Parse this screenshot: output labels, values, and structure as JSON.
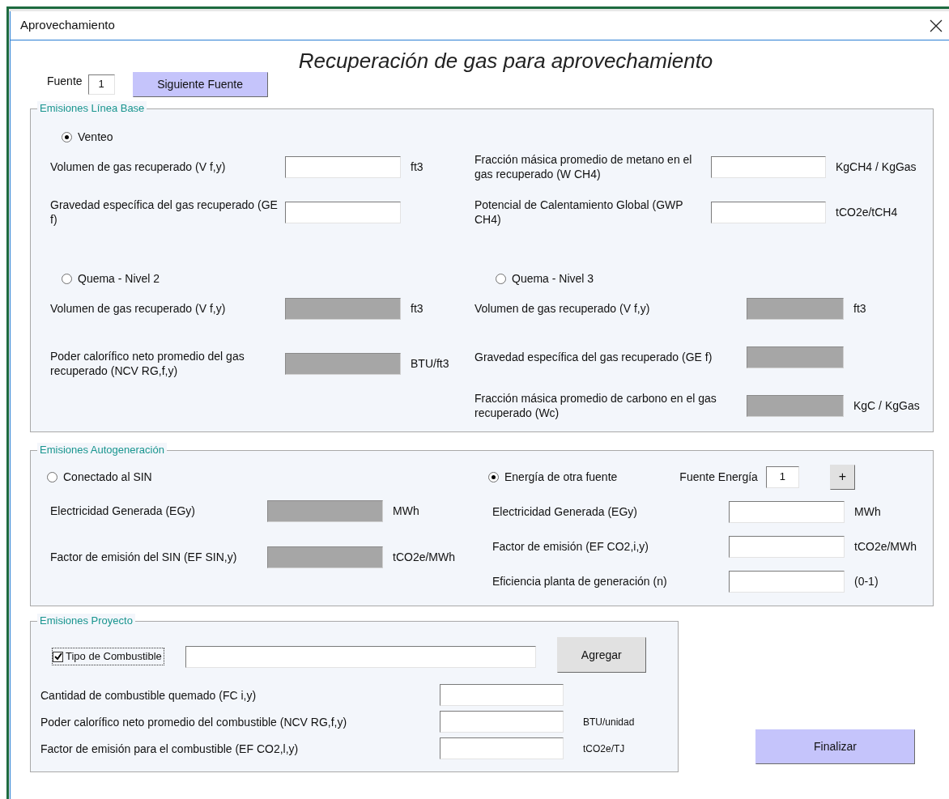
{
  "window": {
    "title": "Aprovechamiento"
  },
  "heading": "Recuperación de gas para aprovechamiento",
  "source": {
    "label": "Fuente",
    "value": "1",
    "button": "Siguiente  Fuente"
  },
  "baseline": {
    "legend": "Emisiones Línea Base",
    "blocks": [
      {
        "options": [
          {
            "label": "Venteo",
            "selected": true
          }
        ],
        "left": [
          {
            "label": "Volumen de gas recuperado (V f,y)",
            "unit": "ft3",
            "disabled": false
          },
          {
            "label": "Gravedad específica del gas recuperado (GE f)",
            "disabled": false
          }
        ],
        "right": [
          {
            "label": "Fracción másica promedio de metano en el gas recuperado (W CH4)",
            "unit": "KgCH4 / KgGas",
            "disabled": false
          },
          {
            "label": "Potencial de Calentamiento Global (GWP CH4)",
            "unit": "tCO2e/tCH4",
            "disabled": false
          }
        ]
      },
      {
        "options": [
          {
            "label": "Quema - Nivel 2",
            "selected": false
          },
          {
            "label": "Quema - Nivel 3",
            "selected": false
          }
        ],
        "left": [
          {
            "label": "Volumen de gas recuperado (V f,y)",
            "unit": "ft3",
            "disabled": true
          },
          {
            "label": "Poder calorífico neto promedio del gas recuperado (NCV RG,f,y)",
            "unit": "BTU/ft3",
            "disabled": true
          }
        ],
        "right": [
          {
            "label": "Volumen de gas recuperado (V f,y)",
            "unit": "ft3",
            "disabled": true
          },
          {
            "label": "Gravedad específica del gas recuperado (GE f)",
            "disabled": true
          },
          {
            "label": "Fracción másica promedio de carbono en el gas recuperado (Wc)",
            "unit": "KgC / KgGas",
            "disabled": true
          }
        ]
      }
    ]
  },
  "autogeneration": {
    "legend": "Emisiones Autogeneración",
    "left": {
      "option": {
        "label": "Conectado al SIN",
        "selected": false
      },
      "fields": [
        {
          "label": "Electricidad Generada (EGy)",
          "unit": "MWh",
          "disabled": true
        },
        {
          "label": "Factor de emisión del SIN (EF SIN,y)",
          "unit": "tCO2e/MWh",
          "disabled": true
        }
      ]
    },
    "right": {
      "option": {
        "label": "Energía de otra fuente",
        "selected": true
      },
      "source": {
        "label": "Fuente Energía",
        "value": "1",
        "button": "+"
      },
      "fields": [
        {
          "label": "Electricidad Generada (EGy)",
          "unit": "MWh",
          "disabled": false
        },
        {
          "label": "Factor de emisión (EF CO2,i,y)",
          "unit": "tCO2e/MWh",
          "disabled": false
        },
        {
          "label": "Eficiencia planta de generación (n)",
          "unit": "(0-1)",
          "disabled": false
        }
      ]
    }
  },
  "project": {
    "legend": "Emisiones Proyecto",
    "fuel_type": {
      "label": "Tipo de Combustible",
      "checked": true
    },
    "add_button": "Agregar",
    "fields": [
      {
        "label": "Cantidad de combustible quemado (FC i,y)",
        "disabled": false
      },
      {
        "label": "Poder calorífico neto promedio del combustible (NCV RG,f,y)",
        "unit": "BTU/unidad",
        "disabled": false
      },
      {
        "label": "Factor de emisión para el combustible (EF CO2,l,y)",
        "unit": "tCO2e/TJ",
        "disabled": false
      }
    ]
  },
  "finish_button": "Finalizar"
}
